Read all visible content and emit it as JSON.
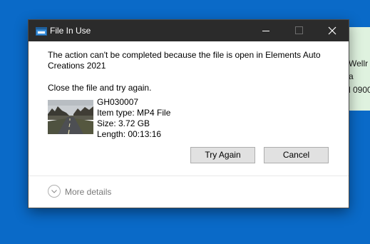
{
  "background_window": {
    "lines": [
      "Wellr",
      "a",
      "l 0900"
    ]
  },
  "dialog": {
    "title": "File In Use",
    "message": "The action can't be completed because the file is open in Elements Auto Creations 2021",
    "instruction": "Close the file and try again.",
    "file": {
      "name": "GH030007",
      "type": "Item type: MP4 File",
      "size": "Size: 3.72 GB",
      "length": "Length: 00:13:16"
    },
    "buttons": {
      "try_again": "Try Again",
      "cancel": "Cancel"
    },
    "more_details": "More details"
  },
  "icons": {
    "app": "file-in-use-icon",
    "minimize": "minimize-icon",
    "maximize": "maximize-icon",
    "close": "close-icon",
    "expand": "chevron-down-icon"
  },
  "colors": {
    "desktop": "#0a6ac8",
    "titlebar": "#2b2b2b",
    "button_face": "#e1e1e1",
    "note": "#dff2df"
  }
}
